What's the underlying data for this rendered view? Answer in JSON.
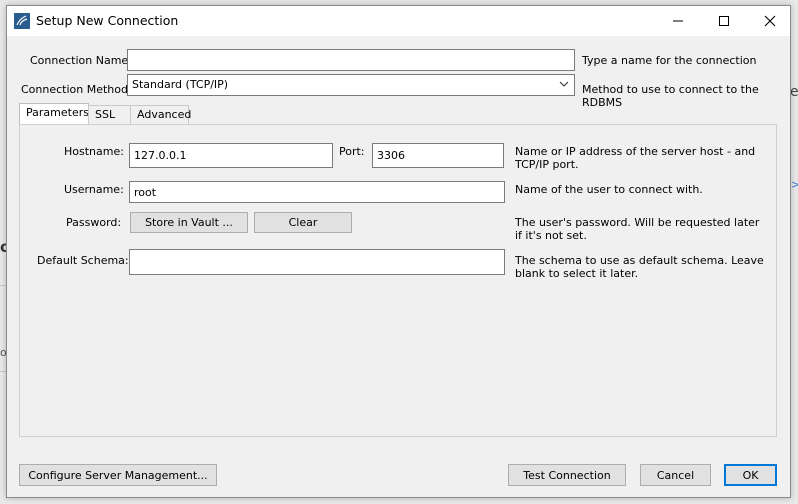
{
  "window": {
    "title": "Setup New Connection"
  },
  "background_fragments": {
    "right_top": "e",
    "right_chevron": ">",
    "left_letter": "o",
    "left_text": "ol"
  },
  "connection": {
    "name_label": "Connection Name:",
    "name_value": "",
    "name_hint": "Type a name for the connection",
    "method_label": "Connection Method:",
    "method_value": "Standard (TCP/IP)",
    "method_hint": "Method to use to connect to the RDBMS"
  },
  "tabs": [
    {
      "label": "Parameters",
      "active": true
    },
    {
      "label": "SSL",
      "active": false
    },
    {
      "label": "Advanced",
      "active": false
    }
  ],
  "parameters": {
    "hostname_label": "Hostname:",
    "hostname_value": "127.0.0.1",
    "port_label": "Port:",
    "port_value": "3306",
    "hostname_hint": "Name or IP address of the server host - and TCP/IP port.",
    "username_label": "Username:",
    "username_value": "root",
    "username_hint": "Name of the user to connect with.",
    "password_label": "Password:",
    "store_vault_label": "Store in Vault ...",
    "clear_label": "Clear",
    "password_hint": "The user's password. Will be requested later if it's not set.",
    "schema_label": "Default Schema:",
    "schema_value": "",
    "schema_hint": "The schema to use as default schema. Leave blank to select it later."
  },
  "footer": {
    "configure_label": "Configure Server Management...",
    "test_label": "Test Connection",
    "cancel_label": "Cancel",
    "ok_label": "OK"
  },
  "icons": {
    "app": "mysql-workbench-icon",
    "minimize": "minimize-icon",
    "maximize": "maximize-icon",
    "close": "close-icon",
    "dropdown": "chevron-down-icon"
  },
  "colors": {
    "dialog_bg": "#f0f0f0",
    "titlebar_bg": "#ffffff",
    "primary_border": "#0078d7",
    "button_bg": "#e1e1e1"
  }
}
